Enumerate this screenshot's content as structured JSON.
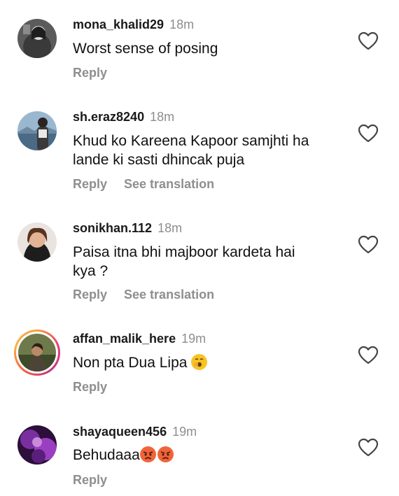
{
  "comments": [
    {
      "username": "mona_khalid29",
      "time": "18m",
      "text": "Worst sense of posing",
      "reply": "Reply"
    },
    {
      "username": "sh.eraz8240",
      "time": "18m",
      "text": "Khud ko Kareena Kapoor samjhti ha lande ki sasti dhincak puja",
      "reply": "Reply",
      "translate": "See translation"
    },
    {
      "username": "sonikhan.112",
      "time": "18m",
      "text": "Paisa itna bhi majboor kardeta hai kya ?",
      "reply": "Reply",
      "translate": "See translation"
    },
    {
      "username": "affan_malik_here",
      "time": "19m",
      "text": "Non pta Dua Lipa",
      "emoji": "yawning-face-emoji",
      "reply": "Reply",
      "has_story_ring": true
    },
    {
      "username": "shayaqueen456",
      "time": "19m",
      "text": "Behudaaa",
      "emoji": "angry-face-emoji x2",
      "reply": "Reply"
    }
  ],
  "icons": {
    "like": "heart-outline-icon"
  }
}
